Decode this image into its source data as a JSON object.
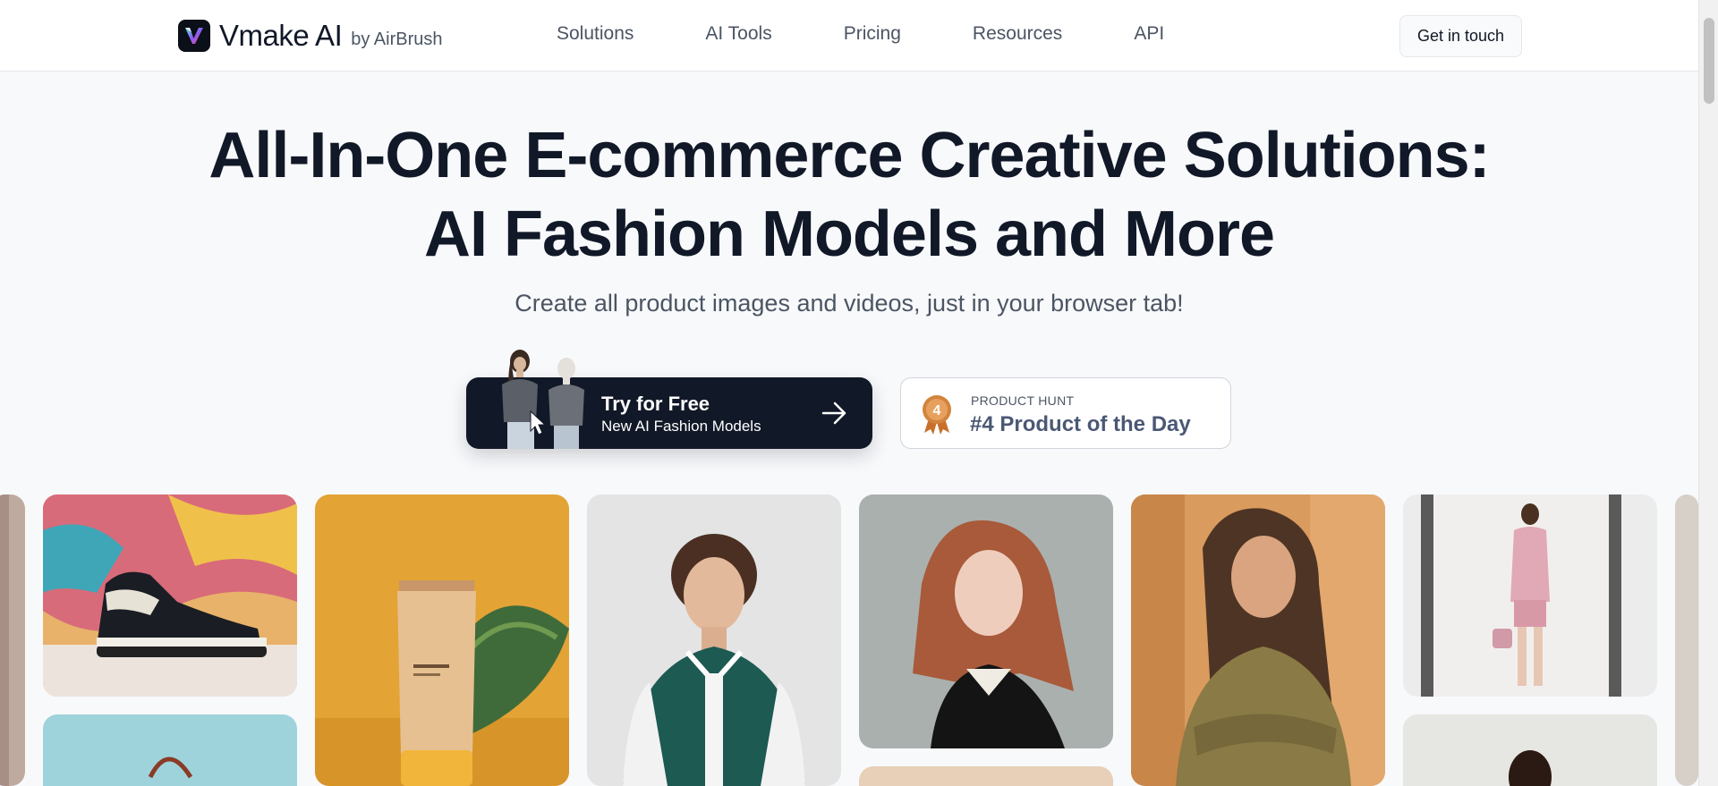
{
  "nav": {
    "brand": "Vmake AI",
    "brand_by": "by AirBrush",
    "links": [
      "Solutions",
      "AI Tools",
      "Pricing",
      "Resources",
      "API"
    ],
    "cta": "Get in touch"
  },
  "hero": {
    "title_line1": "All-In-One E-commerce Creative Solutions:",
    "title_line2": "AI Fashion Models and More",
    "subtitle": "Create all product images and videos, just in your browser tab!"
  },
  "try_button": {
    "title": "Try for Free",
    "subtitle": "New AI Fashion Models"
  },
  "product_hunt": {
    "label": "PRODUCT HUNT",
    "title": "#4 Product of the Day",
    "rank": "4"
  },
  "gallery": {
    "items": [
      "sneaker-image",
      "cosmetic-tube-image",
      "varsity-jacket-model-image",
      "redhead-model-image",
      "cardigan-model-image",
      "pink-suit-model-image"
    ]
  },
  "colors": {
    "primary_dark": "#111827",
    "accent_text": "#4b5875",
    "medal": "#c8702a",
    "background": "#f8f9fb"
  }
}
